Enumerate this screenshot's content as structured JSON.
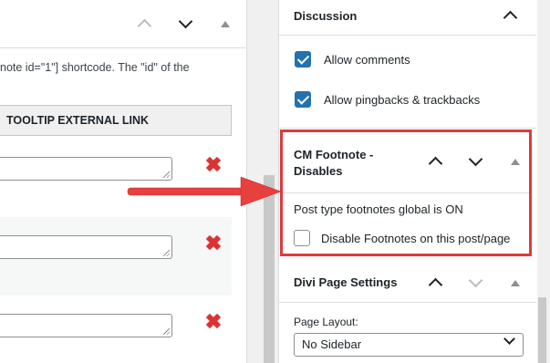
{
  "editor": {
    "shortcode_text": "note id=\"1\"] shortcode. The \"id\" of the",
    "tooltip_column_header": "TOOLTIP EXTERNAL LINK"
  },
  "sidebar": {
    "discussion": {
      "title": "Discussion",
      "options": [
        {
          "label": "Allow comments",
          "checked": true
        },
        {
          "label": "Allow pingbacks & trackbacks",
          "checked": true
        }
      ]
    },
    "cm_footnote": {
      "title_line1": "CM Footnote -",
      "title_line2": "Disables",
      "status_text": "Post type footnotes global is ON",
      "disable_label": "Disable Footnotes on this post/page",
      "disable_checked": false
    },
    "divi": {
      "title": "Divi Page Settings",
      "page_layout_label": "Page Layout:",
      "page_layout_value": "No Sidebar"
    }
  },
  "colors": {
    "highlight": "#e03a3a",
    "checkbox": "#2271b1",
    "delete": "#dc3232"
  }
}
